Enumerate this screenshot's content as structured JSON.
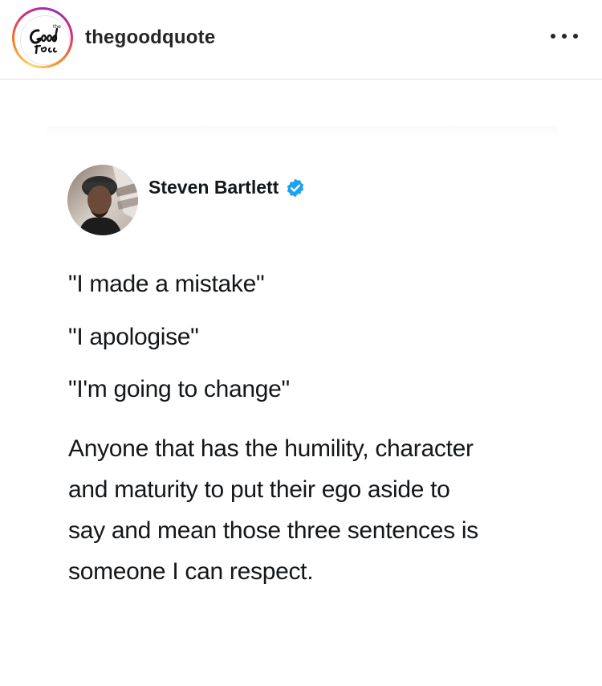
{
  "post": {
    "account": {
      "username": "thegoodquote",
      "avatar": "thegoodquote-logo",
      "logo_text": "Good"
    },
    "more_icon": "more-options-icon"
  },
  "tweet": {
    "author": {
      "name": "Steven Bartlett",
      "verified": true,
      "verified_color": "#1da1f2",
      "avatar": "steven-bartlett-photo"
    },
    "quotes": [
      "\"I made a mistake\"",
      "\"I apologise\"",
      "\"I'm going to change\""
    ],
    "body_lines": [
      "Anyone that has the humility, character",
      "and maturity to put their ego aside to",
      "say and mean those three sentences is",
      "someone I can respect."
    ]
  },
  "colors": {
    "text": "#262626",
    "tweet_text": "#14171a",
    "divider": "#e3e3e3",
    "ring_gradient": [
      "#feda75",
      "#fa7e1e",
      "#d62976",
      "#962fbf"
    ]
  }
}
